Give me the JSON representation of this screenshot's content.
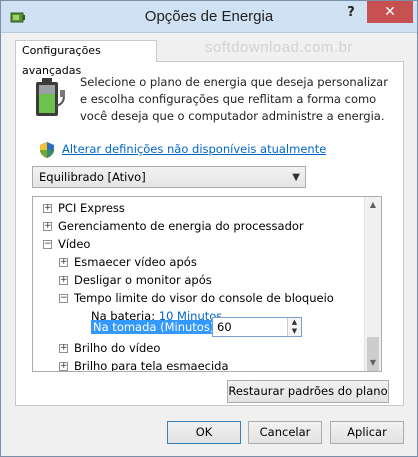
{
  "window": {
    "title": "Opções de Energia",
    "help_label": "?",
    "close_label": "✕"
  },
  "tab": {
    "label": "Configurações avançadas"
  },
  "watermark": "softdownload.com.br",
  "description": "Selecione o plano de energia que deseja personalizar e escolha configurações que reflitam a forma como você deseja que o computador administre a energia.",
  "link_text": "Alterar definições não disponíveis atualmente",
  "plan_select": {
    "selected": "Equilibrado [Ativo]",
    "arrow": "▼"
  },
  "tree": {
    "items": [
      {
        "label": "PCI Express",
        "expander": "+"
      },
      {
        "label": "Gerenciamento de energia do processador",
        "expander": "+"
      },
      {
        "label": "Vídeo",
        "expander": "−"
      },
      {
        "label": "Esmaecer vídeo após",
        "expander": "+"
      },
      {
        "label": "Desligar o monitor após",
        "expander": "+"
      },
      {
        "label": "Tempo limite do visor do console de bloqueio",
        "expander": "−"
      },
      {
        "label": "Brilho do vídeo",
        "expander": "+"
      },
      {
        "label": "Brilho para tela esmaecida",
        "expander": "+"
      }
    ],
    "battery_label": "Na bateria:",
    "battery_value": "10 Minutos",
    "plugged_label": "Na tomada (Minutos):",
    "plugged_value": "60"
  },
  "buttons": {
    "restore": "Restaurar padrões do plano",
    "ok": "OK",
    "cancel": "Cancelar",
    "apply": "Aplicar"
  },
  "colors": {
    "link": "#0066cc",
    "selection": "#3399ff",
    "close": "#c75050"
  }
}
